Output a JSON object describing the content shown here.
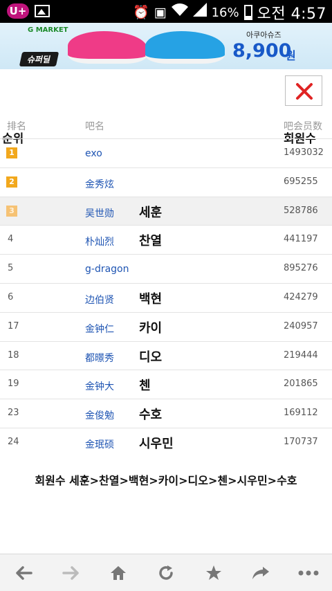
{
  "status_bar": {
    "carrier": "U+",
    "battery": "16%",
    "time": "오전 4:57",
    "icons": [
      "uplus-icon",
      "image-icon",
      "alarm-icon",
      "notification-icon",
      "wifi-icon",
      "signal-icon",
      "battery-icon"
    ]
  },
  "ad": {
    "brand": "G MARKET",
    "badge": "슈퍼딜",
    "product": "아쿠아슈즈",
    "price": "8,900",
    "currency": "원",
    "colors": {
      "pink_shoe": "#ef3b87",
      "blue_shoe": "#26a2e4",
      "price": "#1859c8"
    }
  },
  "close_button": {
    "icon": "close-icon",
    "color": "#e02424"
  },
  "table": {
    "headers": {
      "rank_cn": "排名",
      "rank_ko": "순위",
      "name_cn": "吧名",
      "members_cn": "吧会员数",
      "members_ko": "회원수"
    },
    "rows": [
      {
        "rank": "1",
        "name": "exo",
        "ko": "",
        "count": "1493032",
        "medal": true,
        "highlight": false
      },
      {
        "rank": "2",
        "name": "金秀炫",
        "ko": "",
        "count": "695255",
        "medal": true,
        "highlight": false
      },
      {
        "rank": "3",
        "name": "吴世勋",
        "ko": "세훈",
        "count": "528786",
        "medal": true,
        "highlight": true
      },
      {
        "rank": "4",
        "name": "朴灿烈",
        "ko": "찬열",
        "count": "441197",
        "medal": false,
        "highlight": false
      },
      {
        "rank": "5",
        "name": "g-dragon",
        "ko": "",
        "count": "895276",
        "medal": false,
        "highlight": false
      },
      {
        "rank": "6",
        "name": "边伯贤",
        "ko": "백현",
        "count": "424279",
        "medal": false,
        "highlight": false
      },
      {
        "rank": "17",
        "name": "金钟仁",
        "ko": "카이",
        "count": "240957",
        "medal": false,
        "highlight": false
      },
      {
        "rank": "18",
        "name": "都暻秀",
        "ko": "디오",
        "count": "219444",
        "medal": false,
        "highlight": false
      },
      {
        "rank": "19",
        "name": "金钟大",
        "ko": "첸",
        "count": "201865",
        "medal": false,
        "highlight": false
      },
      {
        "rank": "23",
        "name": "金俊勉",
        "ko": "수호",
        "count": "169112",
        "medal": false,
        "highlight": false
      },
      {
        "rank": "24",
        "name": "金珉硕",
        "ko": "시우민",
        "count": "170737",
        "medal": false,
        "highlight": false
      }
    ]
  },
  "summary": "회원수 세훈>찬열>백현>카이>디오>첸>시우민>수호",
  "bottom_nav": [
    {
      "icon": "back-arrow-icon"
    },
    {
      "icon": "forward-arrow-icon"
    },
    {
      "icon": "home-icon"
    },
    {
      "icon": "refresh-icon"
    },
    {
      "icon": "bookmark-star-icon"
    },
    {
      "icon": "share-icon"
    },
    {
      "icon": "more-icon"
    }
  ]
}
